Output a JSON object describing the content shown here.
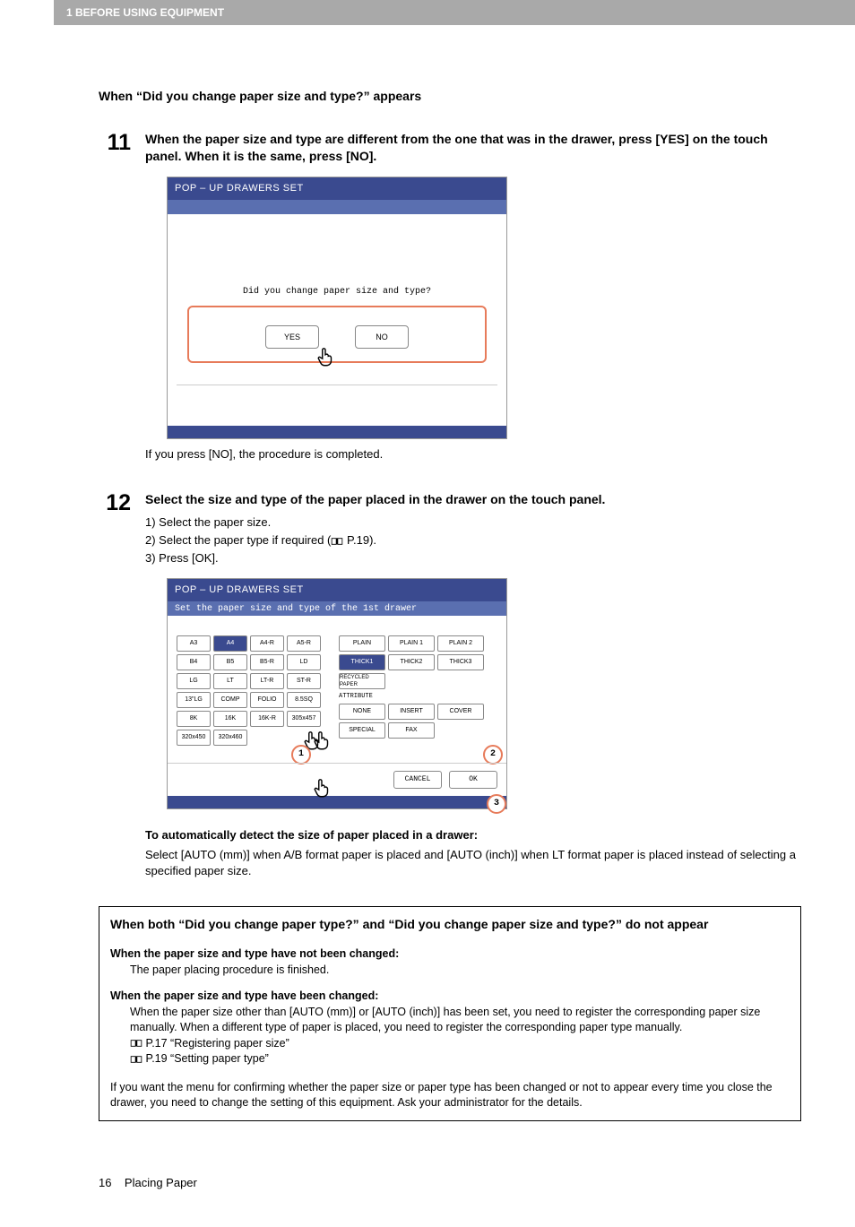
{
  "header": {
    "chapter": "1 BEFORE USING EQUIPMENT"
  },
  "prompt_heading": "When “Did you change paper size and type?” appears",
  "step11": {
    "num": "11",
    "title": "When the paper size and type are different from the one that was in the drawer, press [YES] on the touch panel. When it is the same, press [NO].",
    "ss": {
      "title": "POP – UP DRAWERS  SET",
      "prompt": "Did you change paper size and type?",
      "yes": "YES",
      "no": "NO"
    },
    "caption": "If you press [NO], the procedure is completed."
  },
  "step12": {
    "num": "12",
    "title": "Select the size and type of the paper placed in the drawer on the touch panel.",
    "items": [
      "1)  Select the paper size.",
      "2)  Select the paper type if required (",
      "3)  Press [OK]."
    ],
    "ref": " P.19).",
    "ss": {
      "title": "POP – UP DRAWERS  SET",
      "sub": "Set the paper size and type of the 1st drawer",
      "size_grid": [
        [
          "A3",
          "A4",
          "A4-R",
          "A5-R"
        ],
        [
          "B4",
          "B5",
          "B5-R",
          "LD"
        ],
        [
          "LG",
          "LT",
          "LT-R",
          "ST-R"
        ],
        [
          "13\"LG",
          "COMP",
          "FOLIO",
          "8.5SQ"
        ],
        [
          "8K",
          "16K",
          "16K-R",
          "305x457"
        ],
        [
          "320x450",
          "320x460",
          "",
          ""
        ]
      ],
      "selected_size": "A4",
      "thickness": [
        [
          "PLAIN",
          "PLAIN 1",
          "PLAIN 2"
        ],
        [
          "THICK1",
          "THICK2",
          "THICK3"
        ],
        [
          "RECYCLED PAPER",
          "",
          ""
        ]
      ],
      "selected_thick": "THICK1",
      "attribute_label": "ATTRIBUTE",
      "attribute": [
        [
          "NONE",
          "INSERT",
          "COVER"
        ],
        [
          "SPECIAL",
          "FAX",
          ""
        ]
      ],
      "cancel": "CANCEL",
      "ok": "OK",
      "callouts": [
        "1",
        "2",
        "3"
      ]
    },
    "auto_head": "To automatically detect the size of paper placed in a drawer:",
    "auto_text": "Select [AUTO (mm)] when A/B format paper is placed and [AUTO (inch)] when LT format paper is placed instead of selecting a specified paper size."
  },
  "box": {
    "title": "When both “Did you change paper type?” and “Did you change paper size and type?” do not appear",
    "sub1": "When the paper size and type have not been changed:",
    "text1": "The paper placing procedure is finished.",
    "sub2": "When the paper size and type have been changed:",
    "text2": "When the paper size other than [AUTO (mm)] or [AUTO (inch)] has been set, you need to register the corresponding paper size manually. When a different type of paper is placed, you need to register the corresponding paper type manually.",
    "ref1": " P.17 “Registering paper size”",
    "ref2": " P.19 “Setting paper type”",
    "final": "If you want the menu for confirming whether the paper size or paper type has been changed or not to appear every time you close the drawer, you need to change the setting of this equipment. Ask your administrator for the details."
  },
  "footer": {
    "page": "16",
    "title": "Placing Paper"
  }
}
